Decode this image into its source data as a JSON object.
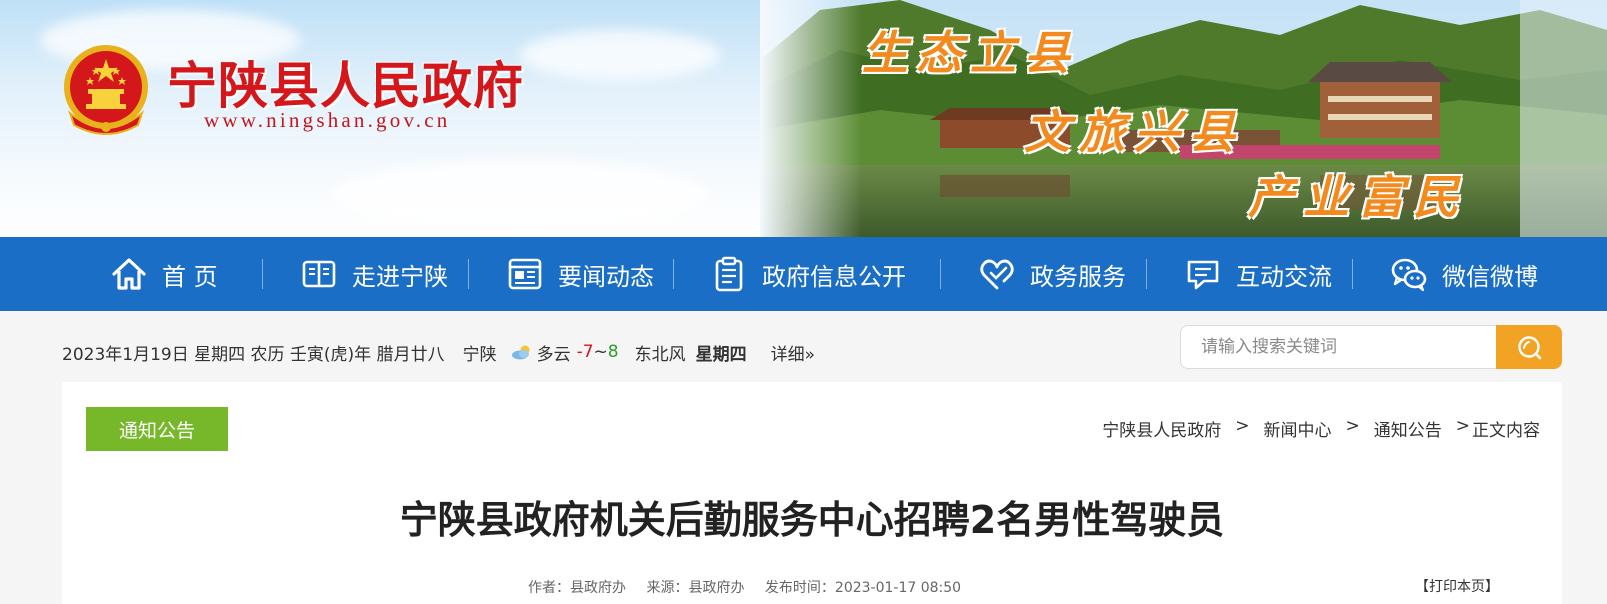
{
  "header": {
    "site_name": "宁陕县人民政府",
    "site_url": "www.ningshan.gov.cn",
    "slogans": [
      "生态立县",
      "文旅兴县",
      "产业富民"
    ]
  },
  "nav": {
    "items": [
      {
        "label": "首 页",
        "icon": "home-icon"
      },
      {
        "label": "走进宁陕",
        "icon": "book-icon"
      },
      {
        "label": "要闻动态",
        "icon": "news-icon"
      },
      {
        "label": "政府信息公开",
        "icon": "clipboard-icon"
      },
      {
        "label": "政务服务",
        "icon": "heart-icon"
      },
      {
        "label": "互动交流",
        "icon": "chat-icon"
      },
      {
        "label": "微信微博",
        "icon": "wechat-icon"
      }
    ]
  },
  "infobar": {
    "date": "2023年1月19日 星期四 农历 壬寅(虎)年 腊月廿八",
    "city": "宁陕",
    "condition": "多云",
    "temp_low": "-7",
    "temp_sep": "~",
    "temp_high": "8",
    "wind": "东北风",
    "weekday": "星期四",
    "detail_link": "详细»"
  },
  "search": {
    "placeholder": "请输入搜索关键词"
  },
  "article": {
    "category_tag": "通知公告",
    "breadcrumb": [
      "宁陕县人民政府",
      "新闻中心",
      "通知公告",
      "正文内容"
    ],
    "breadcrumb_sep": ">",
    "title": "宁陕县政府机关后勤服务中心招聘2名男性驾驶员",
    "author": "作者：县政府办",
    "source": "来源：县政府办",
    "published": "发布时间：2023-01-17 08:50",
    "print_label": "【打印本页】"
  },
  "colors": {
    "brand_red": "#d3171b",
    "nav_blue": "#1a6ec6",
    "tag_green": "#76b82a",
    "search_orange": "#f3a324",
    "slogan_orange": "#f28a1e"
  }
}
